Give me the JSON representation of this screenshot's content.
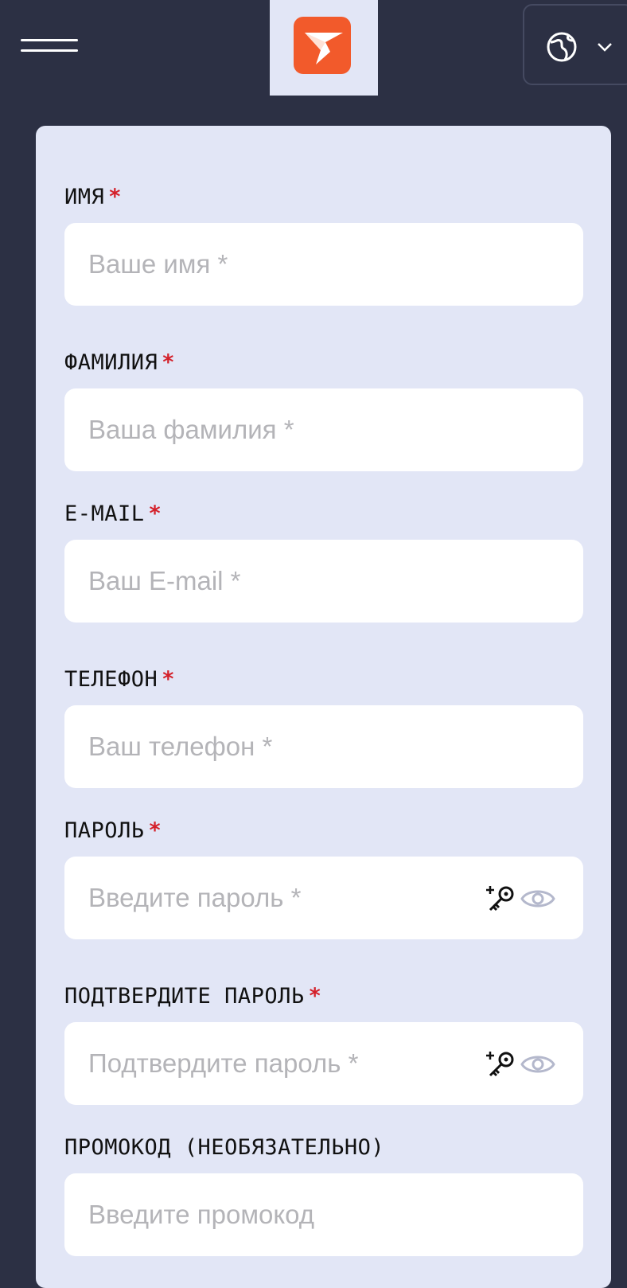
{
  "header": {
    "menu_icon": "hamburger-icon",
    "logo_icon": "paper-plane-logo",
    "language_icon": "globe-icon",
    "language_dropdown_icon": "chevron-down-icon"
  },
  "colors": {
    "background": "#2c3044",
    "card": "#e2e6f6",
    "brand": "#f25a2b",
    "required": "#d4202a"
  },
  "form": {
    "first_name": {
      "label": "ИМЯ",
      "required_mark": "*",
      "placeholder": "Ваше имя *"
    },
    "last_name": {
      "label": "ФАМИЛИЯ",
      "required_mark": "*",
      "placeholder": "Ваша фамилия *"
    },
    "email": {
      "label": "E-MAIL",
      "required_mark": "*",
      "placeholder": "Ваш E-mail *"
    },
    "phone": {
      "label": "ТЕЛЕФОН",
      "required_mark": "*",
      "placeholder": "Ваш телефон *"
    },
    "password": {
      "label": "ПАРОЛЬ",
      "required_mark": "*",
      "placeholder": "Введите пароль *",
      "generate_icon": "key-sparkle-icon",
      "toggle_icon": "eye-icon"
    },
    "confirm_password": {
      "label": "ПОДТВЕРДИТЕ ПАРОЛЬ",
      "required_mark": "*",
      "placeholder": "Подтвердите пароль *",
      "generate_icon": "key-sparkle-icon",
      "toggle_icon": "eye-icon"
    },
    "promo": {
      "label": "ПРОМОКОД (НЕОБЯЗАТЕЛЬНО)",
      "placeholder": "Введите промокод"
    }
  }
}
